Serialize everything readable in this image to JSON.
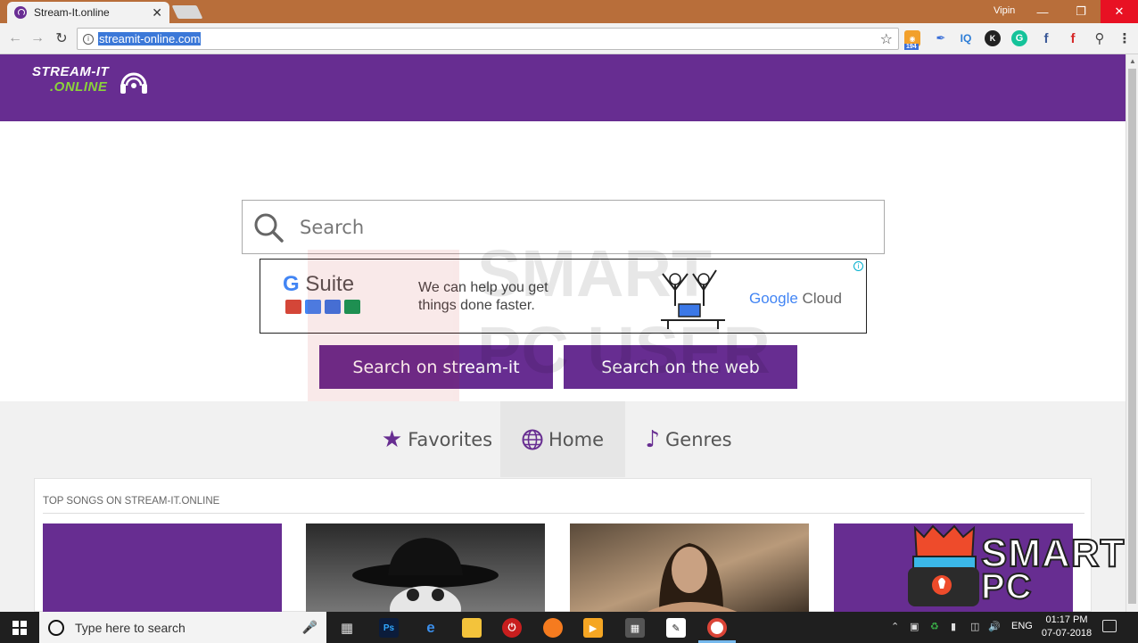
{
  "browser": {
    "tab_title": "Stream-It.online",
    "tab_close": "✕",
    "user": "Vipin",
    "url": "streamit-online.com",
    "rss_badge": "194",
    "ext_iq": "IQ",
    "ext_k": "K",
    "ext_g": "G",
    "ext_fb": "f",
    "ext_flip": "f"
  },
  "header": {
    "logo_line1": "STREAM-IT",
    "logo_line2": ".ONLINE"
  },
  "search": {
    "placeholder": "Search"
  },
  "ad": {
    "brand_g": "G",
    "brand_rest": " Suite",
    "tagline": "We can help you get things done faster.",
    "cloud_google": "Google",
    "cloud_text": " Cloud",
    "info": "i"
  },
  "buttons": {
    "search_streamit": "Search on stream-it",
    "search_web": "Search on the web"
  },
  "tabs": [
    {
      "label": "Favorites",
      "icon": "star-icon"
    },
    {
      "label": "Home",
      "icon": "globe-icon"
    },
    {
      "label": "Genres",
      "icon": "music-note-icon"
    }
  ],
  "panel": {
    "title": "TOP SONGS ON STREAM-IT.ONLINE"
  },
  "watermark": {
    "line1": "SMART",
    "line2": "PC USER"
  },
  "brand": {
    "line1": "SMART",
    "line2": "PC USER"
  },
  "taskbar": {
    "search_placeholder": "Type here to search",
    "ps_label": "Ps",
    "lang": "ENG",
    "time": "01:17 PM",
    "date": "07-07-2018"
  },
  "colors": {
    "accent": "#672d91",
    "logo_green": "#8bd33b",
    "titlebar": "#b86e3a"
  }
}
